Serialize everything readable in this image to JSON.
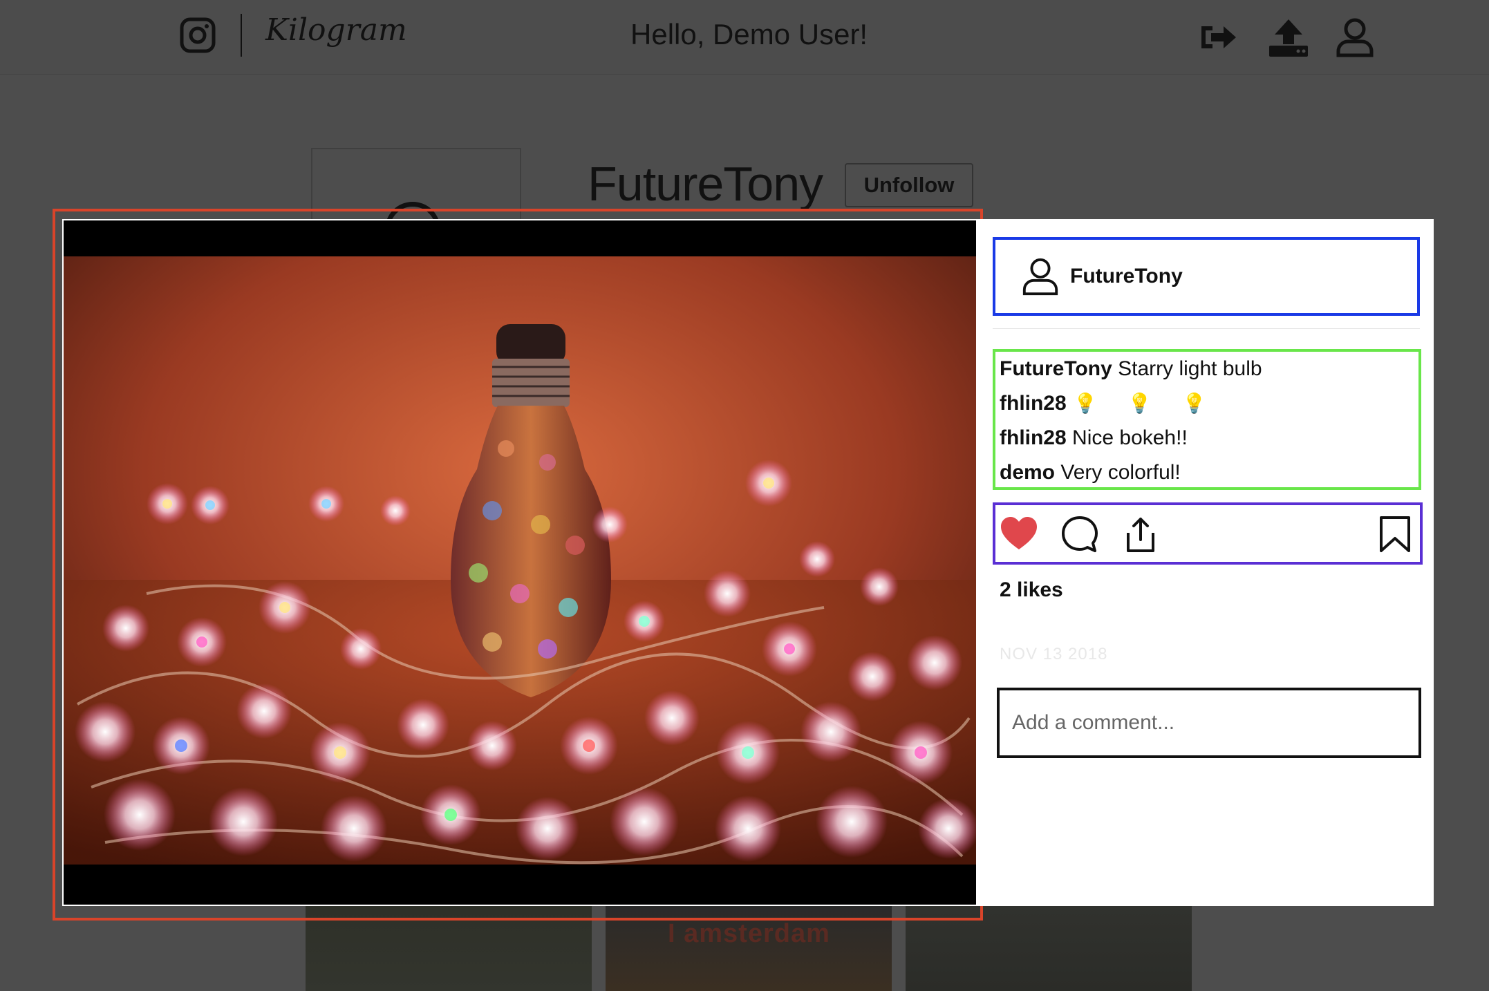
{
  "nav": {
    "logo_text": "Kilogram",
    "greeting": "Hello, Demo User!",
    "icons": [
      "instagram-icon",
      "logout-icon",
      "upload-icon",
      "user-profile-icon"
    ]
  },
  "profile": {
    "username": "FutureTony",
    "follow_button": "Unfollow",
    "grid_tile_text": "I amsterdam"
  },
  "post": {
    "author": "FutureTony",
    "comments": [
      {
        "user": "FutureTony",
        "text": "Starry light bulb"
      },
      {
        "user": "fhlin28",
        "text": "💡 💡 💡"
      },
      {
        "user": "fhlin28",
        "text": "Nice bokeh!!"
      },
      {
        "user": "demo",
        "text": "Very colorful!"
      }
    ],
    "likes": "2 likes",
    "date": "NOV 13 2018",
    "comment_placeholder": "Add a comment...",
    "liked": true,
    "colors": {
      "heart": "#e0474c",
      "photo_outline": "#d9442a",
      "header_outline": "#1a3ae6",
      "comments_outline": "#69e64a",
      "actions_outline": "#5a2fd4"
    }
  }
}
